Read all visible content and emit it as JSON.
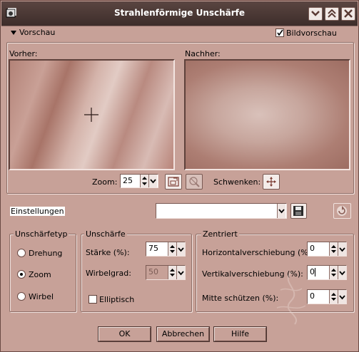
{
  "window": {
    "title": "Strahlenförmige Unschärfe"
  },
  "title_buttons": {
    "help": "help-icon",
    "maximize": "maximize-icon",
    "close": "close-icon"
  },
  "preview_section": {
    "toggle_label": "Vorschau",
    "bildvorschau_label": "Bildvorschau",
    "bildvorschau_checked": true,
    "before_label": "Vorher:",
    "after_label": "Nachher:",
    "zoom_label": "Zoom:",
    "zoom_value": "25",
    "pan_label": "Schwenken:"
  },
  "settings": {
    "label": "Einstellungen",
    "preset_value": ""
  },
  "blur_type": {
    "group_title": "Unschärfetyp",
    "options": [
      {
        "label": "Drehung",
        "selected": false
      },
      {
        "label": "Zoom",
        "selected": true
      },
      {
        "label": "Wirbel",
        "selected": false
      }
    ]
  },
  "blur": {
    "group_title": "Unschärfe",
    "strength_label": "Stärke (%):",
    "strength_value": "75",
    "twirl_label": "Wirbelgrad:",
    "twirl_value": "50",
    "elliptical_label": "Elliptisch",
    "elliptical_checked": false
  },
  "center": {
    "group_title": "Zentriert",
    "h_offset_label": "Horizontalverschiebung (%):",
    "h_offset_value": "0",
    "v_offset_label": "Vertikalverschiebung (%):",
    "v_offset_value": "0",
    "protect_center_label": "Mitte schützen (%):",
    "protect_center_value": "0"
  },
  "buttons": {
    "ok": "OK",
    "cancel": "Abbrechen",
    "help": "Hilfe"
  },
  "colors": {
    "dialog_bg": "#c7a198",
    "titlebar": "#3d2d2a"
  }
}
